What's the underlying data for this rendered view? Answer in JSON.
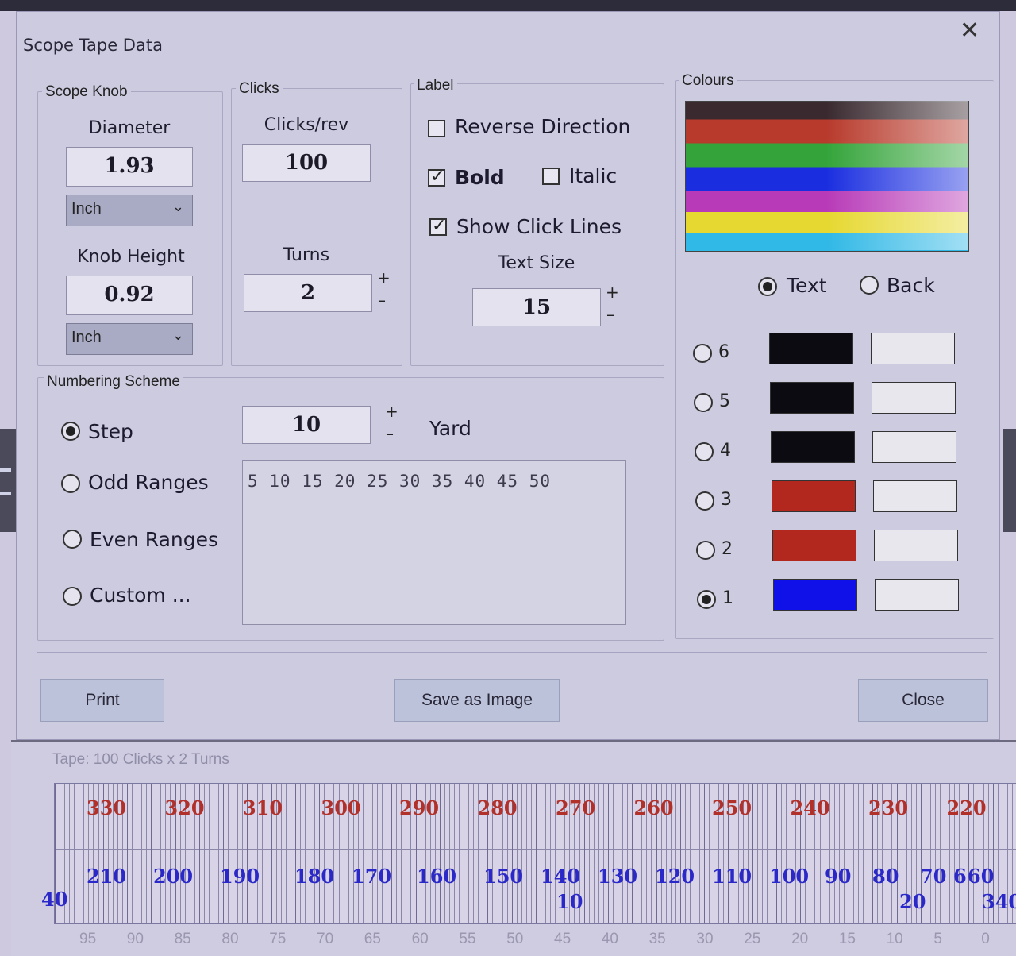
{
  "dialog": {
    "title": "Scope Tape Data",
    "close_glyph": "✕"
  },
  "scope_knob": {
    "legend": "Scope Knob",
    "diameter_label": "Diameter",
    "diameter_value": "1.93",
    "diameter_unit": "Inch",
    "height_label": "Knob Height",
    "height_value": "0.92",
    "height_unit": "Inch"
  },
  "clicks": {
    "legend": "Clicks",
    "clicks_rev_label": "Clicks/rev",
    "clicks_rev_value": "100",
    "turns_label": "Turns",
    "turns_value": "2",
    "plus": "+",
    "minus": "–"
  },
  "label": {
    "legend": "Label",
    "reverse_direction": "Reverse Direction",
    "reverse_checked": false,
    "bold": "Bold",
    "bold_checked": true,
    "italic": "Italic",
    "italic_checked": false,
    "show_click_lines": "Show Click Lines",
    "show_click_lines_checked": true,
    "text_size_label": "Text Size",
    "text_size_value": "15"
  },
  "numbering": {
    "legend": "Numbering Scheme",
    "options": [
      "Step",
      "Odd Ranges",
      "Even Ranges",
      "Custom ..."
    ],
    "selected": "Step",
    "step_value": "10",
    "unit": "Yard",
    "sequence": "5 10 15 20 25 30 35 40 45 50"
  },
  "colours": {
    "legend": "Colours",
    "mode_text": "Text",
    "mode_back": "Back",
    "mode_selected": "Text",
    "rows": [
      {
        "label": "6",
        "text_color": "#0d0b12",
        "back_color": "#e8e7ee"
      },
      {
        "label": "5",
        "text_color": "#0d0b12",
        "back_color": "#e8e7ee"
      },
      {
        "label": "4",
        "text_color": "#0d0b12",
        "back_color": "#e8e7ee"
      },
      {
        "label": "3",
        "text_color": "#b3281e",
        "back_color": "#e8e7ee"
      },
      {
        "label": "2",
        "text_color": "#b3281e",
        "back_color": "#e8e7ee"
      },
      {
        "label": "1",
        "text_color": "#1010e8",
        "back_color": "#e8e7ee"
      }
    ],
    "selected_row": "1"
  },
  "buttons": {
    "print": "Print",
    "save_image": "Save as Image",
    "close": "Close"
  },
  "tape": {
    "caption": "Tape: 100 Clicks x 2 Turns",
    "red_numbers": [
      "330",
      "320",
      "310",
      "300",
      "290",
      "280",
      "270",
      "260",
      "250",
      "240",
      "230",
      "220"
    ],
    "blue_numbers": [
      "210",
      "200",
      "190",
      "180",
      "170",
      "160",
      "150",
      "140",
      "130",
      "120",
      "110",
      "100",
      "90",
      "80",
      "70",
      "6",
      "60"
    ],
    "blue_low": [
      "10",
      "20",
      "340"
    ],
    "left_number": "40",
    "scale": [
      "95",
      "90",
      "85",
      "80",
      "75",
      "70",
      "65",
      "60",
      "55",
      "50",
      "45",
      "40",
      "35",
      "30",
      "25",
      "20",
      "15",
      "10",
      "5",
      "0"
    ]
  }
}
